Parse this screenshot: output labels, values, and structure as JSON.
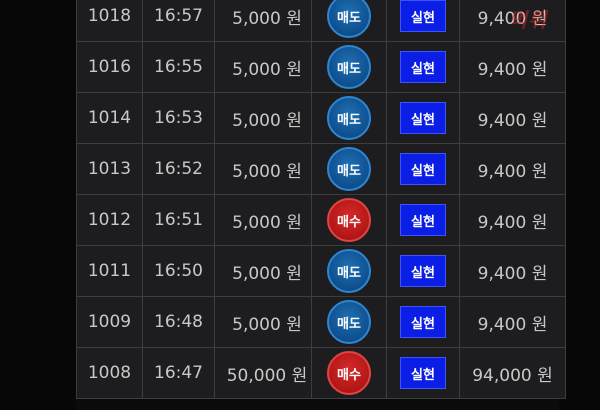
{
  "rows": [
    {
      "id": "1018",
      "time": "16:57",
      "amount": "5,000 원",
      "side": "매도",
      "side_type": "sell",
      "action": "실현",
      "result": "9,400 원"
    },
    {
      "id": "1016",
      "time": "16:55",
      "amount": "5,000 원",
      "side": "매도",
      "side_type": "sell",
      "action": "실현",
      "result": "9,400 원"
    },
    {
      "id": "1014",
      "time": "16:53",
      "amount": "5,000 원",
      "side": "매도",
      "side_type": "sell",
      "action": "실현",
      "result": "9,400 원"
    },
    {
      "id": "1013",
      "time": "16:52",
      "amount": "5,000 원",
      "side": "매도",
      "side_type": "sell",
      "action": "실현",
      "result": "9,400 원"
    },
    {
      "id": "1012",
      "time": "16:51",
      "amount": "5,000 원",
      "side": "매수",
      "side_type": "buy",
      "action": "실현",
      "result": "9,400 원"
    },
    {
      "id": "1011",
      "time": "16:50",
      "amount": "5,000 원",
      "side": "매도",
      "side_type": "sell",
      "action": "실현",
      "result": "9,400 원"
    },
    {
      "id": "1009",
      "time": "16:48",
      "amount": "5,000 원",
      "side": "매도",
      "side_type": "sell",
      "action": "실현",
      "result": "9,400 원"
    },
    {
      "id": "1008",
      "time": "16:47",
      "amount": "50,000 원",
      "side": "매수",
      "side_type": "buy",
      "action": "실현",
      "result": "94,000 원"
    }
  ],
  "watermark": "먹튀",
  "colors": {
    "sell_badge": "#0e4f8e",
    "buy_badge": "#b31616",
    "realize_button": "#0a1ee6",
    "row_background": "#1d1d1f",
    "border": "#3d3d40"
  }
}
